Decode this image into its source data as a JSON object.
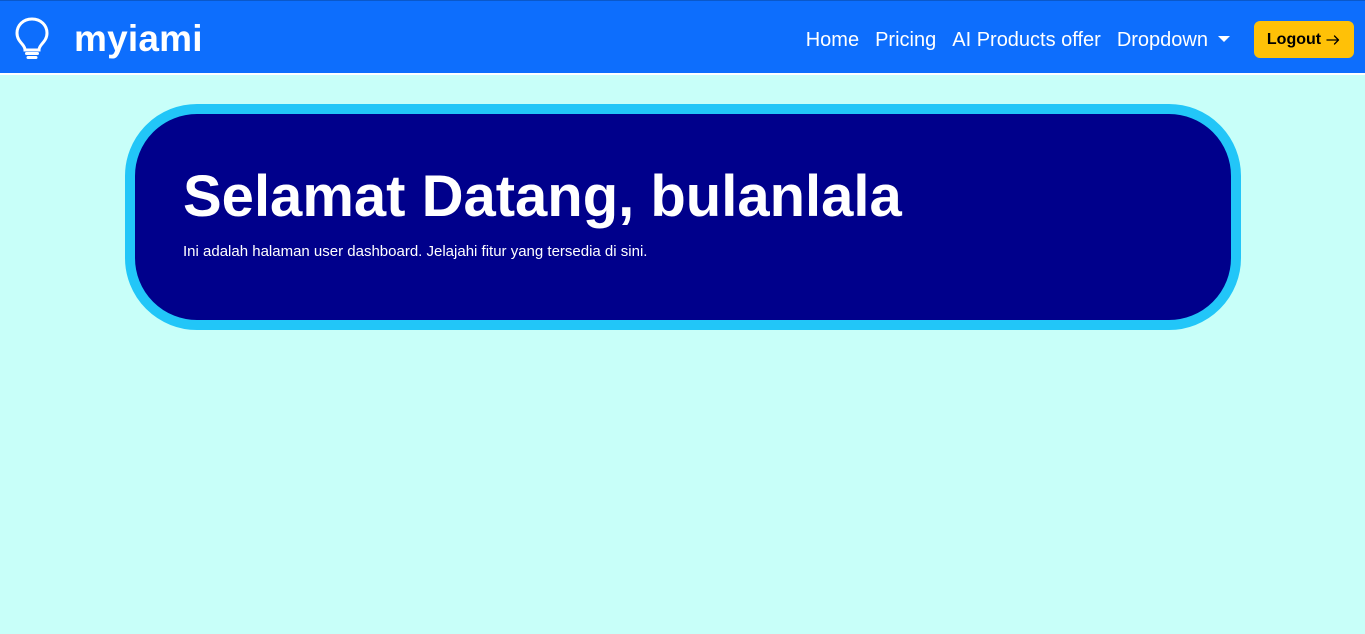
{
  "navbar": {
    "brand": {
      "icon": "lightbulb-icon",
      "name": "myiami"
    },
    "links": [
      {
        "label": "Home"
      },
      {
        "label": "Pricing"
      },
      {
        "label": "AI Products offer"
      },
      {
        "label": "Dropdown",
        "icon": "caret-down-icon"
      }
    ],
    "logout": {
      "label": "Logout",
      "icon": "arrow-right-icon"
    }
  },
  "hero": {
    "title": "Selamat Datang, bulanlala",
    "subtitle": "Ini adalah halaman user dashboard. Jelajahi fitur yang tersedia di sini."
  },
  "colors": {
    "navbar_bg": "#0d6efd",
    "page_bg": "#c8fff9",
    "hero_bg": "#00008b",
    "hero_border": "#22c6f8",
    "logout_bg": "#ffc107"
  }
}
